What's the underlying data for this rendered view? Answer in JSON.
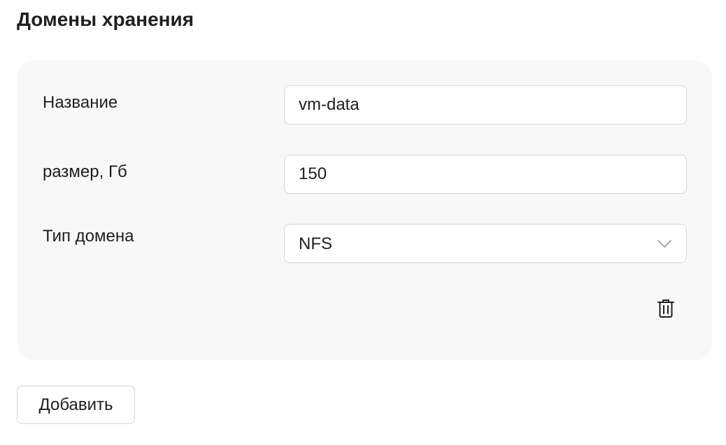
{
  "section": {
    "title": "Домены хранения"
  },
  "form": {
    "name": {
      "label": "Название",
      "value": "vm-data"
    },
    "size": {
      "label": "размер, Гб",
      "value": "150"
    },
    "domain_type": {
      "label": "Тип домена",
      "selected": "NFS"
    }
  },
  "icons": {
    "select_arrow": "chevron-down-icon",
    "delete": "trash-icon"
  },
  "actions": {
    "add_label": "Добавить"
  },
  "colors": {
    "card_background": "#f8f8f8",
    "border": "#d6d6d6",
    "text": "#1f1f1f"
  }
}
